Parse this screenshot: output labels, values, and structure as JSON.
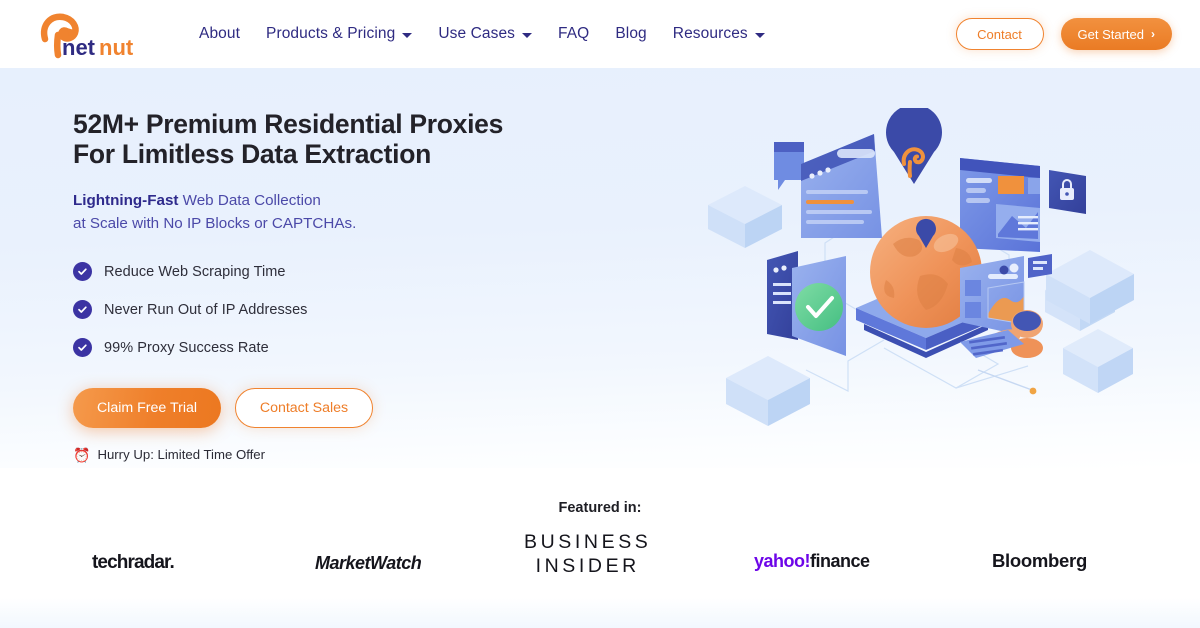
{
  "header": {
    "logo": {
      "name": "netnut-logo",
      "text_dark": "net",
      "text_orange": "nut"
    },
    "nav": [
      {
        "label": "About",
        "has_dropdown": false
      },
      {
        "label": "Products & Pricing",
        "has_dropdown": true
      },
      {
        "label": "Use Cases",
        "has_dropdown": true
      },
      {
        "label": "FAQ",
        "has_dropdown": false
      },
      {
        "label": "Blog",
        "has_dropdown": false
      },
      {
        "label": "Resources",
        "has_dropdown": true
      }
    ],
    "contact_label": "Contact",
    "get_started_label": "Get Started",
    "get_started_chevron": "›"
  },
  "hero": {
    "headline_line1": "52M+ Premium Residential Proxies",
    "headline_line2": "For Limitless Data Extraction",
    "subhead_strong": "Lightning-Fast",
    "subhead_rest": " Web Data Collection",
    "subhead_line2": "at Scale with No IP Blocks or CAPTCHAs.",
    "bullets": [
      {
        "label": "Reduce Web Scraping Time",
        "icon": "check-circle-icon"
      },
      {
        "label": "Never Run Out of IP Addresses",
        "icon": "check-circle-icon"
      },
      {
        "label": "99% Proxy Success Rate",
        "icon": "check-circle-icon"
      }
    ],
    "cta_primary": "Claim Free Trial",
    "cta_secondary": "Contact Sales",
    "urgency_emoji": "⏰",
    "urgency_text": "Hurry Up: Limited Time Offer",
    "illustration_name": "isometric-proxy-network-illustration"
  },
  "featured": {
    "title": "Featured in:",
    "brands": [
      {
        "name": "techradar",
        "label": "techradar."
      },
      {
        "name": "marketwatch",
        "label": "MarketWatch"
      },
      {
        "name": "business-insider",
        "line1": "BUSINESS",
        "line2": "INSIDER"
      },
      {
        "name": "yahoo-finance",
        "label_purple": "yahoo!",
        "label_black": "finance"
      },
      {
        "name": "bloomberg",
        "label": "Bloomberg"
      }
    ]
  },
  "colors": {
    "brand_orange": "#ee7d28",
    "brand_indigo": "#2f2b82",
    "check_indigo": "#3b33a3",
    "hero_bg_top": "#e7f0fd",
    "headline_dark": "#232229",
    "yahoo_purple": "#6d05e8"
  }
}
